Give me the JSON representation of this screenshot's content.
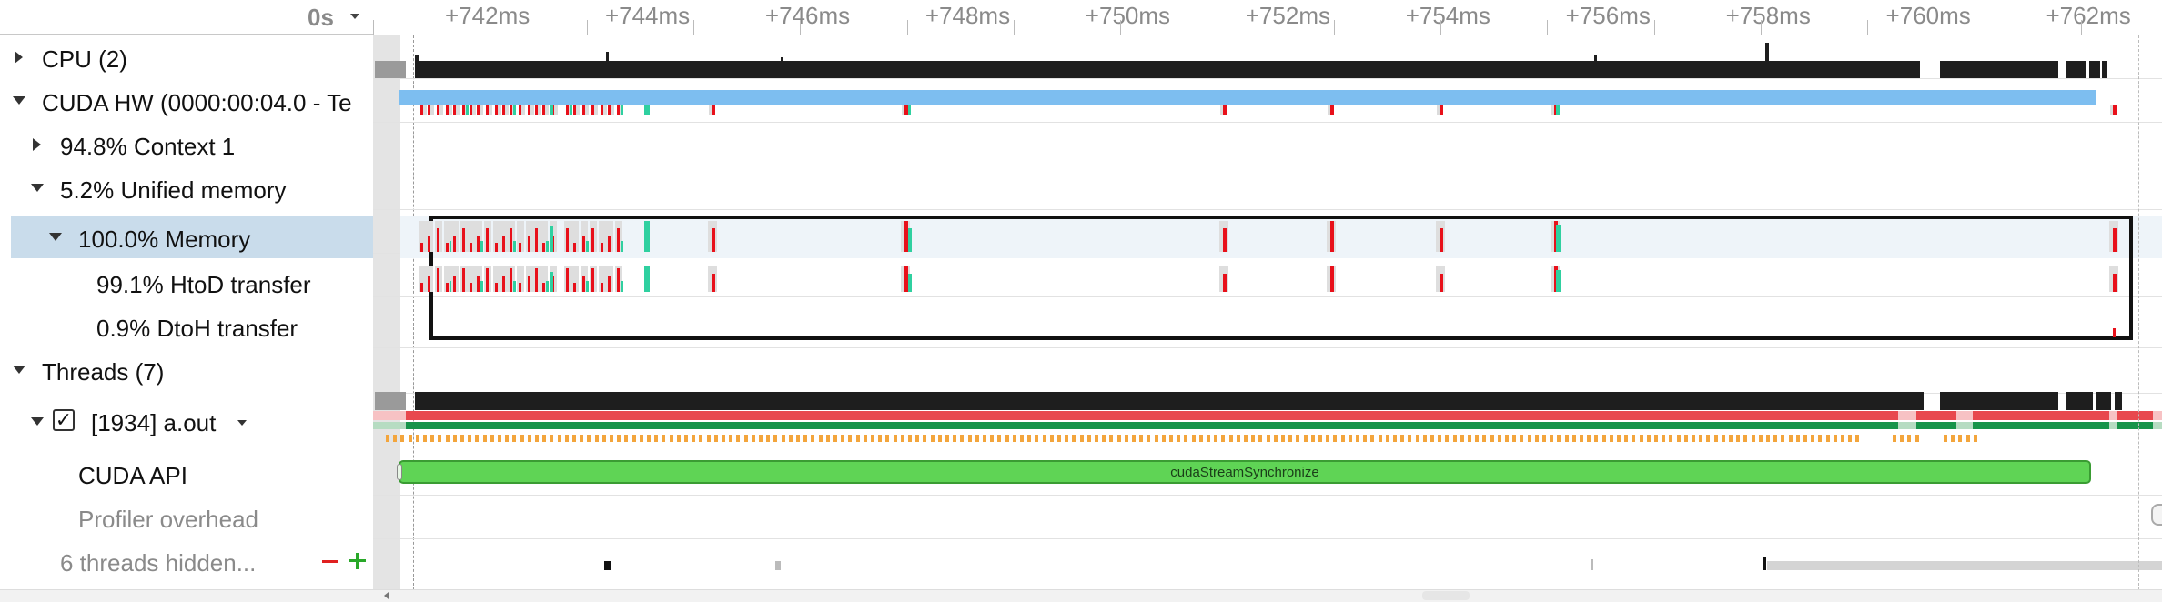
{
  "ruler": {
    "origin": "0s",
    "ticks": [
      "+742ms",
      "+744ms",
      "+746ms",
      "+748ms",
      "+750ms",
      "+752ms",
      "+754ms",
      "+756ms",
      "+758ms",
      "+760ms",
      "+762ms"
    ]
  },
  "tree": {
    "cpu": "CPU (2)",
    "cuda_hw": "CUDA HW (0000:00:04.0 - Te",
    "context": "94.8% Context 1",
    "unified": "5.2% Unified memory",
    "memory": "100.0% Memory",
    "htod": "99.1% HtoD transfer",
    "dtoh": "0.9% DtoH transfer",
    "threads": "Threads (7)",
    "process": "[1934] a.out",
    "cuda_api": "CUDA API",
    "profiler": "Profiler overhead",
    "hidden": "6 threads hidden..."
  },
  "timeline": {
    "api_call": "cudaStreamSynchronize"
  },
  "colors": {
    "selected_row": "#c9dceb",
    "htod_red": "#e8101a",
    "transfer_teal": "#2fd0a0",
    "kernel_blue": "#7dbef0",
    "api_green": "#5fd455",
    "cpu_black": "#1e1e1e",
    "thread_red": "#e8484e",
    "thread_green": "#17944a",
    "thread_orange": "#f3a53c"
  }
}
